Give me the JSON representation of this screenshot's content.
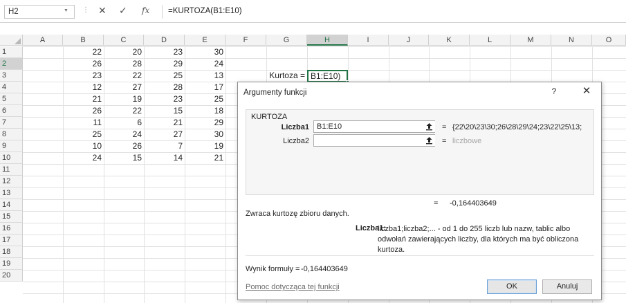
{
  "formula_bar": {
    "name_box": "H2",
    "dots": "⋮",
    "cancel_glyph": "✕",
    "enter_glyph": "✓",
    "fx_glyph": "fx",
    "formula": "=KURTOZA(B1:E10)"
  },
  "columns": [
    "A",
    "B",
    "C",
    "D",
    "E",
    "F",
    "G",
    "H",
    "I",
    "J",
    "K",
    "L",
    "M",
    "N",
    "O"
  ],
  "rows": [
    "1",
    "2",
    "3",
    "4",
    "5",
    "6",
    "7",
    "8",
    "9",
    "10",
    "11",
    "12",
    "13",
    "14",
    "15",
    "16",
    "17",
    "18",
    "19",
    "20"
  ],
  "data": {
    "B": [
      "22",
      "26",
      "23",
      "12",
      "21",
      "26",
      "11",
      "25",
      "10",
      "24"
    ],
    "C": [
      "20",
      "28",
      "22",
      "27",
      "19",
      "22",
      "6",
      "24",
      "26",
      "15"
    ],
    "D": [
      "23",
      "29",
      "25",
      "28",
      "23",
      "15",
      "21",
      "27",
      "7",
      "14"
    ],
    "E": [
      "30",
      "24",
      "13",
      "17",
      "25",
      "18",
      "29",
      "30",
      "19",
      "21"
    ]
  },
  "cells": {
    "g2": "Kurtoza =",
    "h2": "B1:E10)"
  },
  "dialog": {
    "title": "Argumenty funkcji",
    "help_glyph": "?",
    "close_glyph": "✕",
    "function_name": "KURTOZA",
    "args": [
      {
        "label": "Liczba1",
        "value": "B1:E10",
        "eq": "=",
        "result": "{22\\20\\23\\30;26\\28\\29\\24;23\\22\\25\\13;"
      },
      {
        "label": "Liczba2",
        "value": "",
        "eq": "=",
        "result": "liczbowe"
      }
    ],
    "result_eq": "=",
    "result_value": "-0,164403649",
    "description": "Zwraca kurtozę zbioru danych.",
    "arg_desc_label": "Liczba1:",
    "arg_desc": "liczba1;liczba2;... - od 1 do 255 liczb lub nazw, tablic albo odwołań zawierających liczby, dla których ma być obliczona kurtoza.",
    "formula_result_label": "Wynik formuły =",
    "formula_result_value": "-0,164403649",
    "help_link": "Pomoc dotycząca tej funkcji",
    "ok_label": "OK",
    "cancel_label": "Anuluj"
  }
}
